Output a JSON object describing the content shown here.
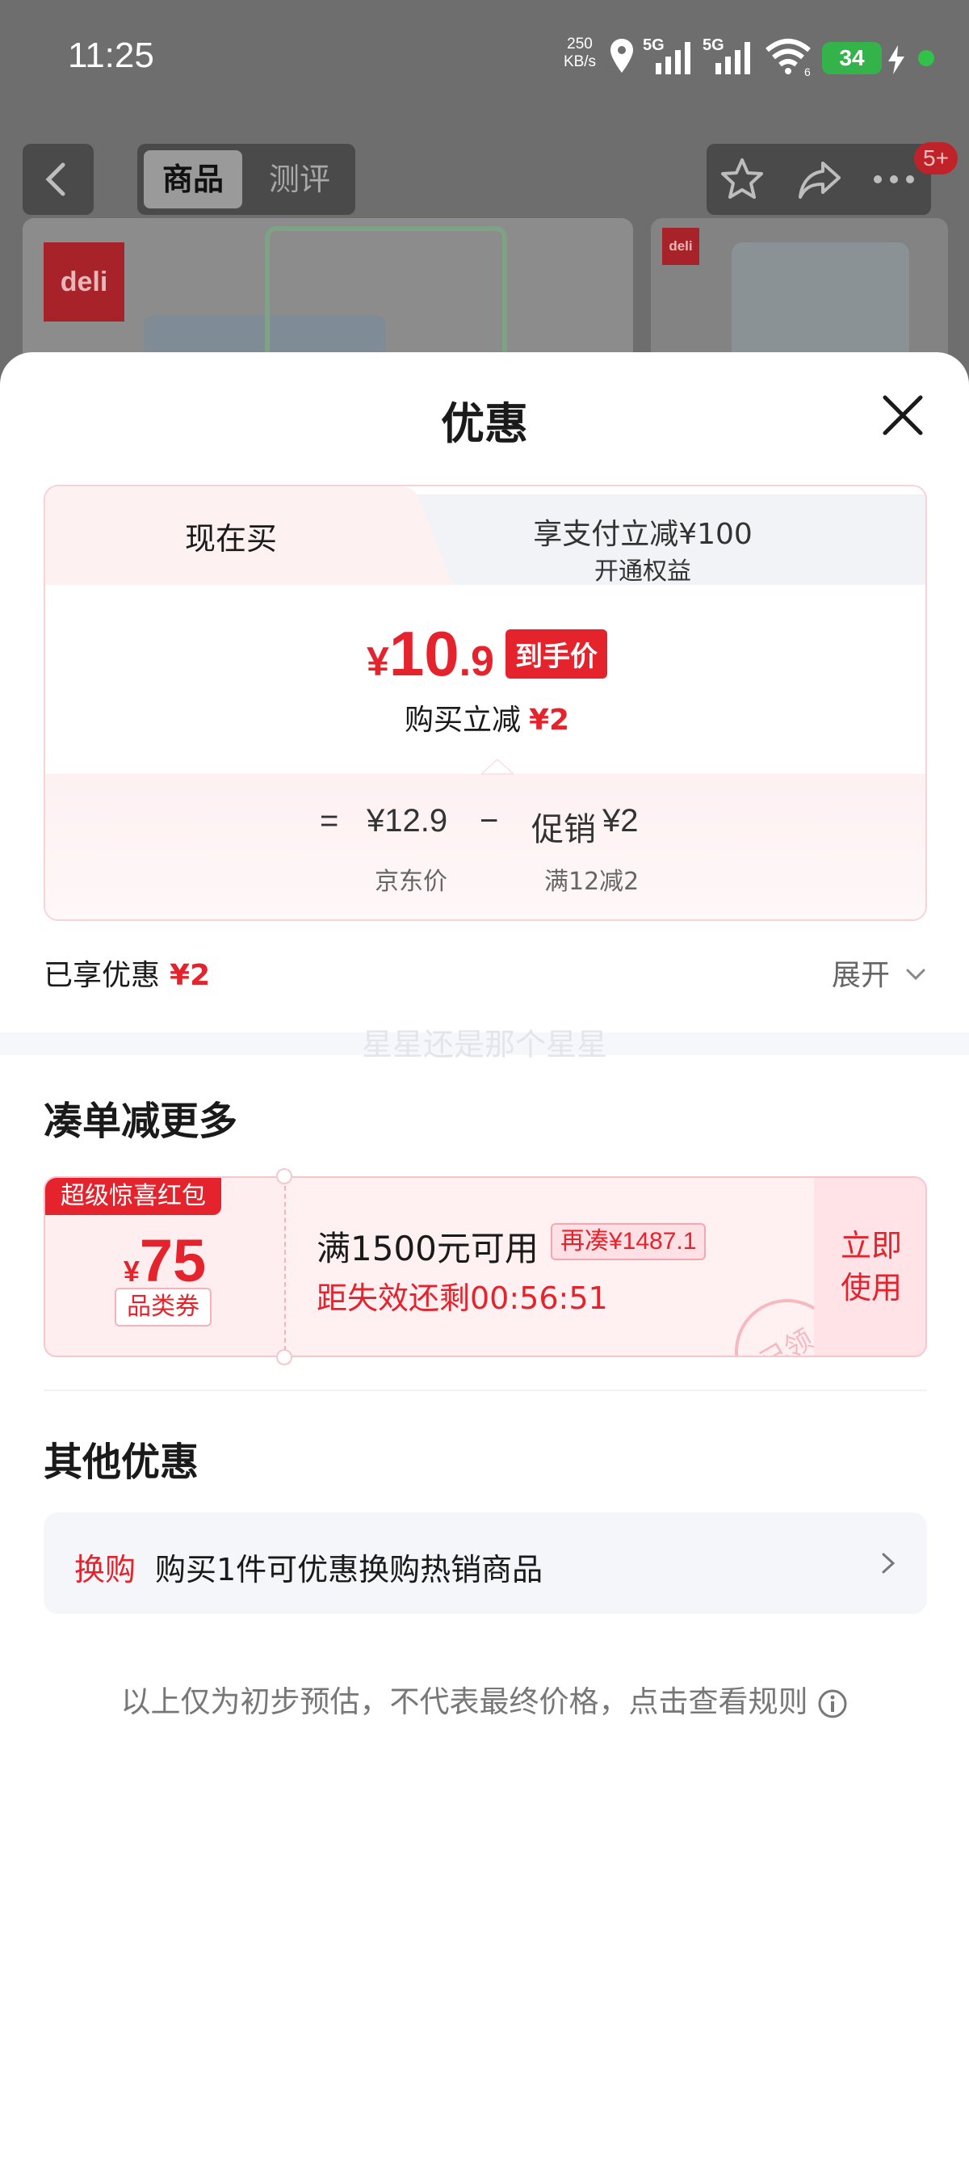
{
  "status_bar": {
    "time": "11:25",
    "net_speed_value": "250",
    "net_speed_unit": "KB/s",
    "signal1_label": "5G",
    "signal2_label": "5G",
    "wifi_label": "6",
    "battery": "34"
  },
  "top_nav": {
    "tabs": [
      "商品",
      "测评"
    ],
    "badge": "5+"
  },
  "product_images": {
    "brand": "deli"
  },
  "sheet": {
    "title": "优惠"
  },
  "price_card": {
    "tab_active": "现在买",
    "tab_inactive_line1": "享支付立减¥100",
    "tab_inactive_line2": "开通权益",
    "final_price_symbol": "¥",
    "final_price_int": "10",
    "final_price_dec": ".9",
    "final_price_tag": "到手价",
    "instant_label": "购买立减",
    "instant_value": "¥2",
    "eq": "=",
    "base_price": "¥12.9",
    "minus": "−",
    "promo_label": "促销",
    "promo_value": "¥2",
    "base_price_sub": "京东价",
    "promo_sub": "满12减2"
  },
  "enjoyed": {
    "label": "已享优惠",
    "value": "¥2",
    "expand_label": "展开"
  },
  "watermark": "星星还是那个星星",
  "more_deals": {
    "section_title": "凑单减更多",
    "coupon": {
      "tag": "超级惊喜红包",
      "amount_symbol": "¥",
      "amount": "75",
      "type": "品类券",
      "condition": "满1500元可用",
      "more_needed": "再凑¥1487.1",
      "countdown": "距失效还剩00:56:51",
      "use_line1": "立即",
      "use_line2": "使用",
      "stamp": "已领"
    }
  },
  "other_deals": {
    "section_title": "其他优惠",
    "swap_tag": "换购",
    "swap_text": "购买1件可优惠换购热销商品"
  },
  "disclaimer": "以上仅为初步预估，不代表最终价格，点击查看规则",
  "colors": {
    "accent_red": "#e5232c",
    "battery_green": "#33b34a"
  },
  "icons": [
    "back-icon",
    "star-icon",
    "share-icon",
    "more-icon",
    "close-icon",
    "chevron-down-icon",
    "chevron-right-icon",
    "info-icon",
    "location-icon",
    "signal-icon",
    "wifi-icon",
    "charging-icon"
  ]
}
